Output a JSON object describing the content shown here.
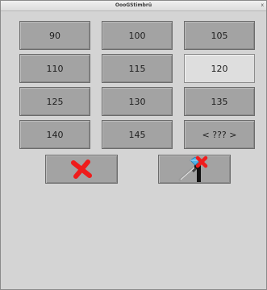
{
  "window": {
    "title": "OooGStimbrü",
    "close_glyph": "x"
  },
  "grid": {
    "buttons": [
      {
        "label": "90",
        "selected": false
      },
      {
        "label": "100",
        "selected": false
      },
      {
        "label": "105",
        "selected": false
      },
      {
        "label": "110",
        "selected": false
      },
      {
        "label": "115",
        "selected": false
      },
      {
        "label": "120",
        "selected": true
      },
      {
        "label": "125",
        "selected": false
      },
      {
        "label": "130",
        "selected": false
      },
      {
        "label": "135",
        "selected": false
      },
      {
        "label": "140",
        "selected": false
      },
      {
        "label": "145",
        "selected": false
      },
      {
        "label": "< ??? >",
        "selected": false
      }
    ]
  },
  "actions": {
    "cancel_icon": "red-x-icon",
    "clear_icon": "sword-with-red-x-icon"
  },
  "colors": {
    "button": "#a3a3a3",
    "button_selected": "#dedede",
    "background": "#d4d4d4",
    "cancel_red": "#ef1c1c"
  }
}
